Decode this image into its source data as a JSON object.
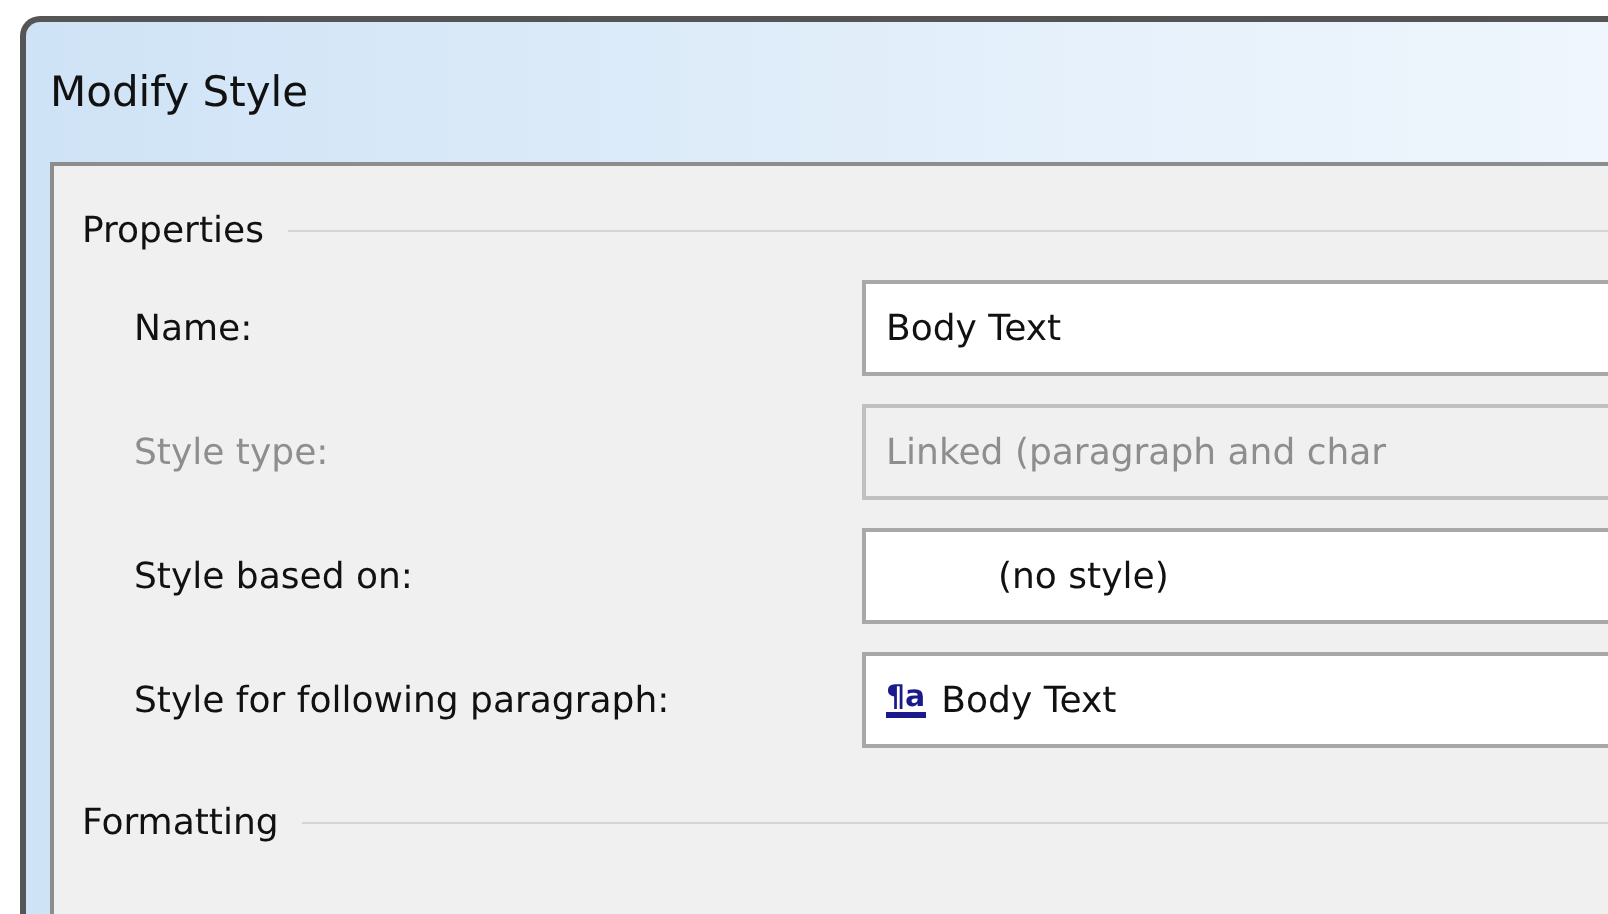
{
  "window": {
    "title": "Modify Style"
  },
  "properties": {
    "heading": "Properties",
    "rows": [
      {
        "label": "Name:",
        "disabled": false,
        "value": "Body Text"
      },
      {
        "label": "Style type:",
        "disabled": true,
        "value": "Linked (paragraph and char"
      },
      {
        "label": "Style based on:",
        "disabled": false,
        "value": "(no style)",
        "indented": true
      },
      {
        "label": "Style for following paragraph:",
        "disabled": false,
        "value": "Body Text",
        "prefix": "¶a"
      }
    ]
  },
  "formatting": {
    "heading": "Formatting"
  }
}
